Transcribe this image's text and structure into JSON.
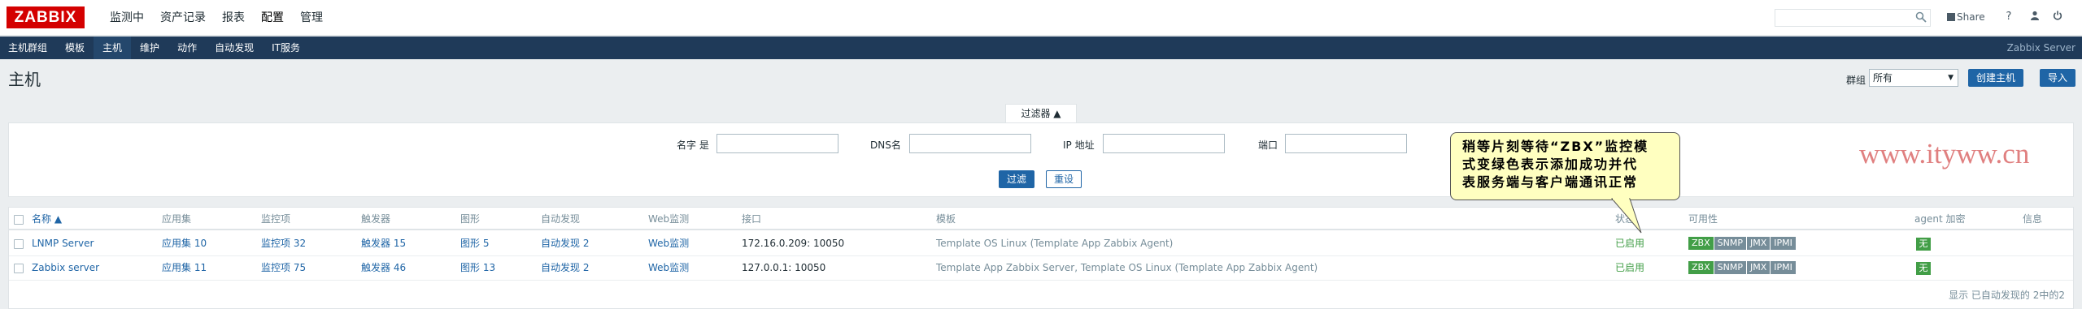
{
  "logo": "ZABBIX",
  "topmenu": [
    "监测中",
    "资产记录",
    "报表",
    "配置",
    "管理"
  ],
  "topbar": {
    "search_placeholder": "",
    "share": "Share",
    "help": "?"
  },
  "submenu": [
    "主机群组",
    "模板",
    "主机",
    "维护",
    "动作",
    "自动发现",
    "IT服务"
  ],
  "server_name": "Zabbix Server",
  "page_title": "主机",
  "group": {
    "label": "群组",
    "value": "所有"
  },
  "buttons": {
    "create": "创建主机",
    "import": "导入"
  },
  "filter": {
    "tab": "过滤器 ▲",
    "fields": [
      {
        "label": "名字 是",
        "value": ""
      },
      {
        "label": "DNS名",
        "value": ""
      },
      {
        "label": "IP 地址",
        "value": ""
      },
      {
        "label": "端口",
        "value": ""
      }
    ],
    "apply": "过滤",
    "reset": "重设"
  },
  "table": {
    "headers": [
      "名称 ▲",
      "应用集",
      "监控项",
      "触发器",
      "图形",
      "自动发现",
      "Web监测",
      "接口",
      "模板",
      "状态",
      "可用性",
      "agent 加密",
      "信息"
    ],
    "rows": [
      {
        "name": "LNMP Server",
        "apps": "应用集 10",
        "items": "监控项 32",
        "triggers": "触发器 15",
        "graphs": "图形 5",
        "discovery": "自动发现 2",
        "web": "Web监测",
        "interface": "172.16.0.209: 10050",
        "templates": "Template OS Linux (Template App Zabbix Agent)",
        "status": "已启用",
        "availability": [
          "ZBX",
          "SNMP",
          "JMX",
          "IPMI"
        ],
        "encryption": "无"
      },
      {
        "name": "Zabbix server",
        "apps": "应用集 11",
        "items": "监控项 75",
        "triggers": "触发器 46",
        "graphs": "图形 13",
        "discovery": "自动发现 2",
        "web": "Web监测",
        "interface": "127.0.0.1: 10050",
        "templates": "Template App Zabbix Server, Template OS Linux (Template App Zabbix Agent)",
        "status": "已启用",
        "availability": [
          "ZBX",
          "SNMP",
          "JMX",
          "IPMI"
        ],
        "encryption": "无"
      }
    ],
    "footer": "显示 已自动发现的 2中的2"
  },
  "callout": {
    "lines": [
      "稍等片刻等待“ZBX”监控模",
      "式变绿色表示添加成功并代",
      "表服务端与客户端通讯正常"
    ]
  },
  "watermark": "www.ityww.cn",
  "colors": {
    "brand": "#d40000",
    "nav": "#1f3a59",
    "link": "#1f65a6",
    "ok": "#429e47",
    "inactive": "#768d99"
  }
}
